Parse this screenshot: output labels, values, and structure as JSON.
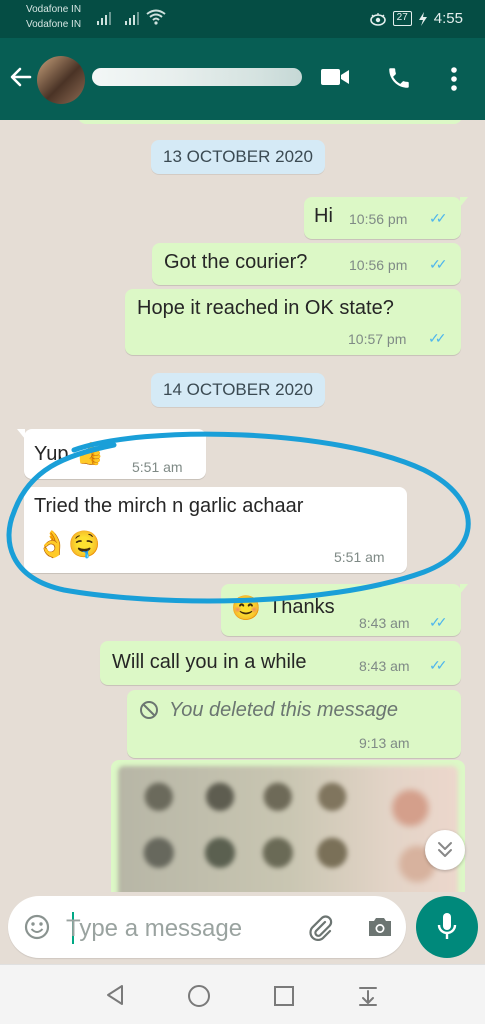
{
  "status_bar": {
    "carrier1": "Vodafone IN",
    "carrier2": "Vodafone IN",
    "battery": "27",
    "time": "4:55"
  },
  "header": {
    "contact_name": "",
    "icons": [
      "back-arrow-icon",
      "avatar",
      "video-call-icon",
      "phone-icon",
      "more-options-icon"
    ]
  },
  "chat": {
    "dates": [
      "13 OCTOBER 2020",
      "14 OCTOBER 2020"
    ],
    "messages": [
      {
        "dir": "out",
        "text": "Hi",
        "time": "10:56 pm",
        "ticks": "✓✓"
      },
      {
        "dir": "out",
        "text": "Got the courier?",
        "time": "10:56 pm",
        "ticks": "✓✓"
      },
      {
        "dir": "out",
        "text": "Hope it reached in OK state?",
        "time": "10:57 pm",
        "ticks": "✓✓"
      },
      {
        "dir": "in",
        "text": "Yup",
        "emoji": "👍",
        "time": "5:51 am"
      },
      {
        "dir": "in",
        "text": "Tried the mirch n garlic achaar",
        "emoji": "👌🤤",
        "time": "5:51 am"
      },
      {
        "dir": "out",
        "text": "Thanks",
        "emoji": "😊",
        "time": "8:43 am",
        "ticks": "✓✓"
      },
      {
        "dir": "out",
        "text": "Will call you in a while",
        "time": "8:43 am",
        "ticks": "✓✓"
      },
      {
        "dir": "out",
        "text": "You deleted this message",
        "time": "9:13 am",
        "deleted": true
      }
    ]
  },
  "composer": {
    "placeholder": "Type a message"
  },
  "colors": {
    "header": "#075e54",
    "status_bar": "#054d44",
    "outgoing_bubble": "#dcf8c6",
    "incoming_bubble": "#ffffff",
    "read_ticks": "#4fb6ec",
    "date_chip": "#d5eaf6",
    "annotation": "#1a9fd8"
  }
}
